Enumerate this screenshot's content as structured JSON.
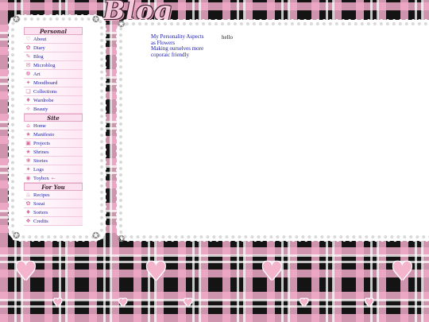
{
  "site": {
    "title": "Blog"
  },
  "sidebar": {
    "sections": [
      {
        "header": "Personal",
        "items": [
          {
            "label": "About",
            "icon": "heart-icon"
          },
          {
            "label": "Diary",
            "icon": "book-icon"
          },
          {
            "label": "Blog",
            "icon": "pencil-icon"
          },
          {
            "label": "Microblog",
            "icon": "note-icon"
          },
          {
            "label": "Art",
            "icon": "palette-icon"
          },
          {
            "label": "Moodboard",
            "icon": "pin-icon"
          },
          {
            "label": "Collections",
            "icon": "box-icon"
          },
          {
            "label": "Wardrobe",
            "icon": "dress-icon"
          },
          {
            "label": "Beauty",
            "icon": "lipstick-icon"
          }
        ]
      },
      {
        "header": "Site",
        "items": [
          {
            "label": "Home",
            "icon": "home-icon"
          },
          {
            "label": "Manifesto",
            "icon": "star-icon"
          },
          {
            "label": "Projects",
            "icon": "folder-icon"
          },
          {
            "label": "Shrines",
            "icon": "shrine-icon"
          },
          {
            "label": "Stories",
            "icon": "scroll-icon"
          },
          {
            "label": "Logs",
            "icon": "wand-icon"
          },
          {
            "label": "Toybox",
            "icon": "toy-icon",
            "suffix": "←"
          }
        ]
      },
      {
        "header": "For You",
        "items": [
          {
            "label": "Recipes",
            "icon": "cake-icon"
          },
          {
            "label": "Sozai",
            "icon": "sticker-icon"
          },
          {
            "label": "Sorters",
            "icon": "bag-icon"
          },
          {
            "label": "Credits",
            "icon": "gift-icon"
          }
        ]
      }
    ]
  },
  "content": {
    "posts": [
      {
        "title": "My Personality Aspects as Flowers"
      },
      {
        "title": "Making ourselves more coporaic friendly"
      }
    ],
    "text": "hello"
  },
  "colors": {
    "accent": "#f3b4cc",
    "link": "#1a1aa8",
    "nav_border": "#e3a5c4"
  }
}
